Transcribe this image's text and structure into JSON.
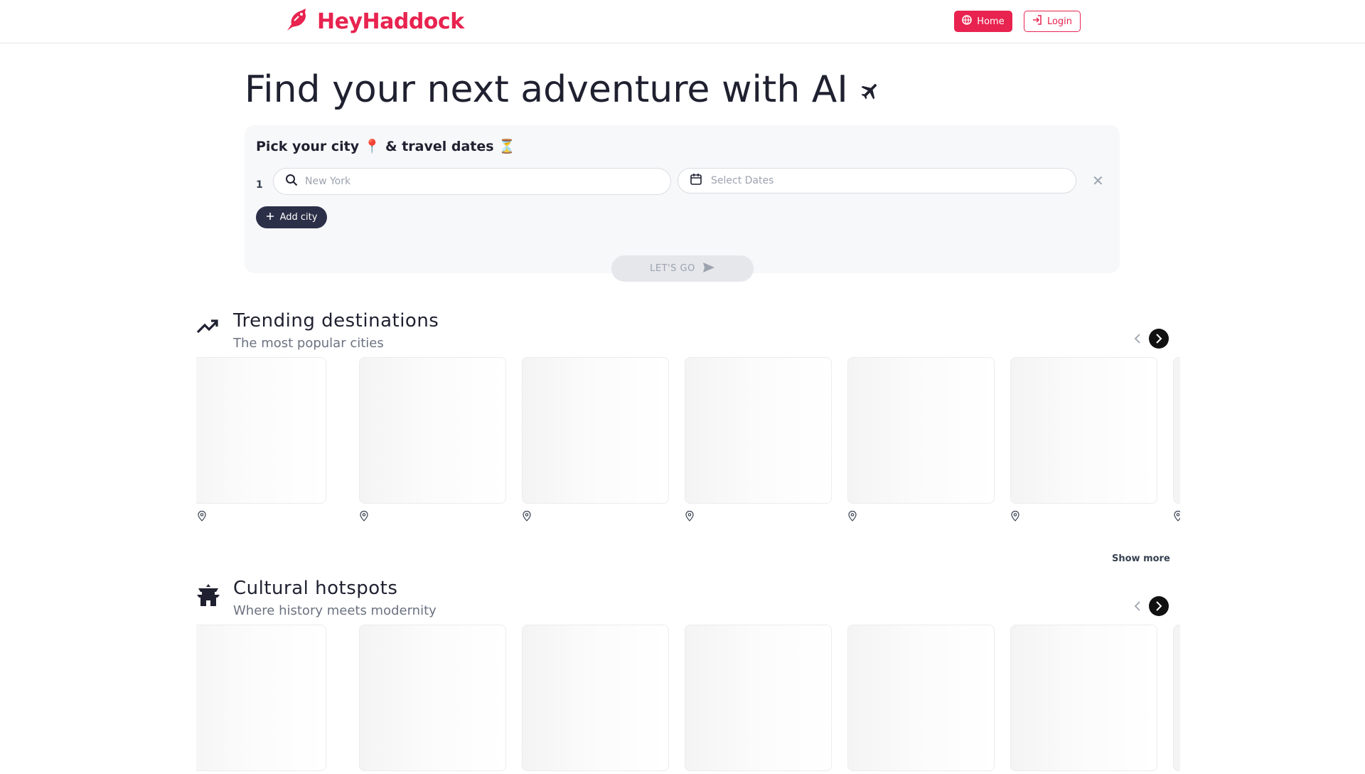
{
  "header": {
    "brand": "HeyHaddock",
    "nav": {
      "home_label": "Home",
      "login_label": "Login"
    },
    "brand_color": "#e8234f"
  },
  "hero": {
    "title": "Find your next adventure with AI",
    "title_icon": "airplane-icon"
  },
  "search_panel": {
    "heading": "Pick your city 📍 & travel dates ⏳",
    "row_index": "1",
    "city_placeholder": "New York",
    "city_value": "",
    "dates_placeholder": "Select Dates",
    "add_city_label": "Add city",
    "submit_label": "LET'S GO"
  },
  "sections": [
    {
      "title": "Trending destinations",
      "subtitle": "The most popular cities",
      "icon": "trending-up-icon",
      "show_more": "Show more",
      "card_count_visible": 7
    },
    {
      "title": "Cultural hotspots",
      "subtitle": "Where history meets modernity",
      "icon": "temple-icon",
      "card_count_visible": 7
    }
  ],
  "colors": {
    "accent": "#e8234f",
    "dark_button": "#2c2f48",
    "panel_bg": "#f7f8fa"
  }
}
